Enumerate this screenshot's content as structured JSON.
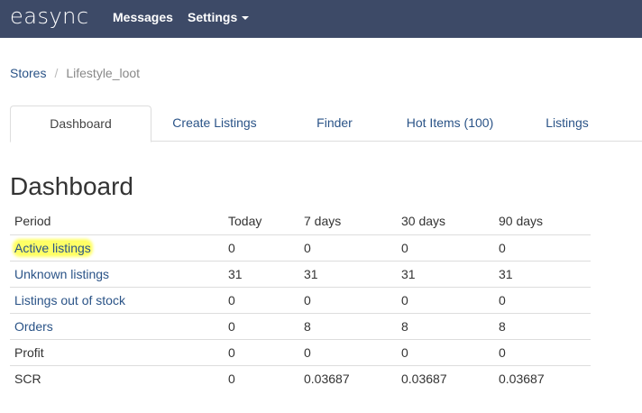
{
  "navbar": {
    "brand": "easync",
    "messages": "Messages",
    "settings": "Settings"
  },
  "breadcrumb": {
    "stores": "Stores",
    "current": "Lifestyle_loot"
  },
  "tabs": [
    {
      "label": "Dashboard",
      "active": true
    },
    {
      "label": "Create Listings",
      "active": false
    },
    {
      "label": "Finder",
      "active": false
    },
    {
      "label": "Hot Items (100)",
      "active": false
    },
    {
      "label": "Listings",
      "active": false
    }
  ],
  "page_title": "Dashboard",
  "table": {
    "headers": [
      "Period",
      "Today",
      "7 days",
      "30 days",
      "90 days"
    ],
    "rows": [
      {
        "label": "Active listings",
        "values": [
          "0",
          "0",
          "0",
          "0"
        ]
      },
      {
        "label": "Unknown listings",
        "values": [
          "31",
          "31",
          "31",
          "31"
        ]
      },
      {
        "label": "Listings out of stock",
        "values": [
          "0",
          "0",
          "0",
          "0"
        ]
      },
      {
        "label": "Orders",
        "values": [
          "0",
          "8",
          "8",
          "8"
        ]
      },
      {
        "label": "Profit",
        "values": [
          "0",
          "0",
          "0",
          "0"
        ]
      },
      {
        "label": "SCR",
        "values": [
          "0",
          "0.03687",
          "0.03687",
          "0.03687"
        ]
      }
    ]
  },
  "colors": {
    "navbar": "#3d4a67",
    "link": "#2a5387",
    "highlight": "#ffff66"
  }
}
